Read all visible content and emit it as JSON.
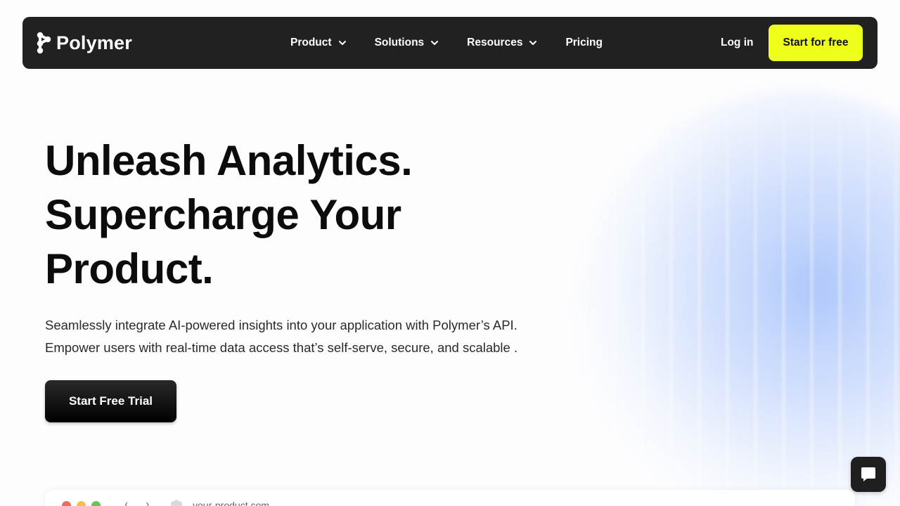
{
  "brand": {
    "name": "Polymer"
  },
  "nav": {
    "items": [
      {
        "label": "Product",
        "has_dropdown": true
      },
      {
        "label": "Solutions",
        "has_dropdown": true
      },
      {
        "label": "Resources",
        "has_dropdown": true
      },
      {
        "label": "Pricing",
        "has_dropdown": false
      }
    ],
    "login_label": "Log in",
    "cta_label": "Start for free"
  },
  "hero": {
    "title_lines": [
      "Unleash Analytics.",
      "Supercharge Your",
      "Product."
    ],
    "subtitle_lines": [
      "Seamlessly integrate AI-powered insights into your application with Polymer’s API.",
      "Empower users with real-time data access that’s self-serve, secure, and scalable ."
    ],
    "cta_label": "Start Free Trial"
  },
  "browser_mock": {
    "url": "your-product.com"
  },
  "icons": {
    "logo": "polymer-logo-icon",
    "chevron": "chevron-down-icon",
    "chat": "chat-bubble-icon",
    "back": "arrow-left-icon",
    "forward": "arrow-right-icon",
    "shield": "shield-icon"
  },
  "colors": {
    "nav_bg": "#212121",
    "cta_yellow": "#eeff1a",
    "hero_button": "#000000",
    "glow_blue": "#a0befa"
  }
}
